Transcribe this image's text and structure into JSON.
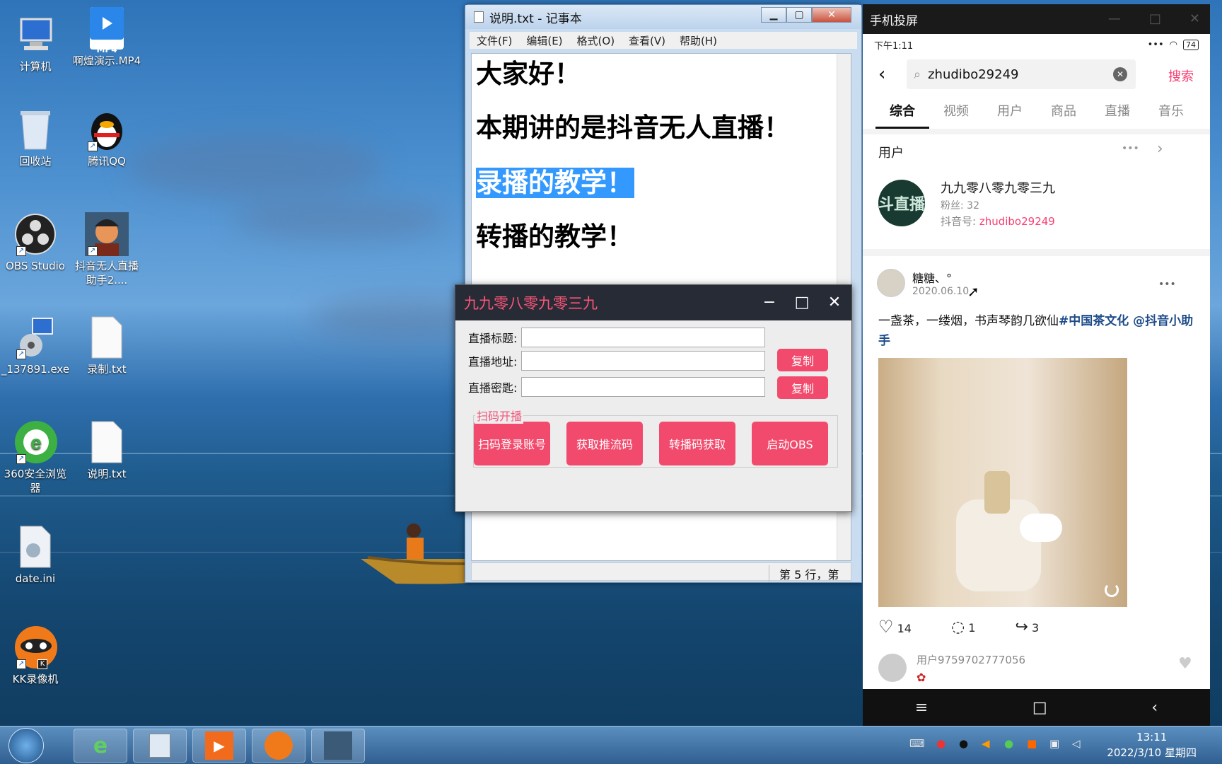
{
  "desktop": {
    "icons": [
      {
        "label": "计算机",
        "icon": "computer-icon"
      },
      {
        "label": "啊煌演示.MP4",
        "icon": "mp4-file-icon",
        "badge": "MP4"
      },
      {
        "label": "回收站",
        "icon": "recycle-bin-icon"
      },
      {
        "label": "腾讯QQ",
        "icon": "qq-penguin-icon"
      },
      {
        "label": "OBS Studio",
        "icon": "obs-icon"
      },
      {
        "label": "抖音无人直播助手2....",
        "icon": "app-avatar-icon"
      },
      {
        "label": "_137891.exe",
        "icon": "installer-icon"
      },
      {
        "label": "录制.txt",
        "icon": "text-file-icon"
      },
      {
        "label": "360安全浏览器",
        "icon": "browser-360-icon"
      },
      {
        "label": "说明.txt",
        "icon": "text-file-icon"
      },
      {
        "label": "date.ini",
        "icon": "ini-file-icon"
      },
      {
        "label": "KK录像机",
        "icon": "kk-recorder-icon",
        "badge": "K"
      }
    ]
  },
  "notepad": {
    "title": "说明.txt - 记事本",
    "menu": [
      "文件(F)",
      "编辑(E)",
      "格式(O)",
      "查看(V)",
      "帮助(H)"
    ],
    "lines": [
      "大家好！",
      "本期讲的是抖音无人直播！",
      "录播的教学！",
      "转播的教学！"
    ],
    "status": "第 5 行，第"
  },
  "tool": {
    "title": "九九零八零九零三九",
    "fields": [
      {
        "label": "直播标题:",
        "value": ""
      },
      {
        "label": "直播地址:",
        "value": ""
      },
      {
        "label": "直播密匙:",
        "value": ""
      }
    ],
    "copy_label": "复制",
    "group_label": "扫码开播",
    "buttons": [
      "扫码登录账号",
      "获取推流码",
      "转播码获取",
      "启动OBS"
    ]
  },
  "phone": {
    "window_title": "手机投屏",
    "time": "下午1:11",
    "battery": "74",
    "search_value": "zhudibo29249",
    "search_button": "搜索",
    "tabs": [
      "综合",
      "视频",
      "用户",
      "商品",
      "直播",
      "音乐"
    ],
    "active_tab": 0,
    "users_section": "用户",
    "user": {
      "avatar_text": "斗直播",
      "name": "九九零八零九零三九",
      "fans": "粉丝: 32",
      "id_label": "抖音号: ",
      "id": "zhudibo29249"
    },
    "post": {
      "author": "糖糖、°",
      "date": "2020.06.10",
      "text": "一盏茶，一缕烟，书声琴韵几欲仙",
      "tags": "#中国茶文化 @抖音小助手",
      "likes": "14",
      "comments": "1",
      "shares": "3"
    },
    "commenter": "用户9759702777056"
  },
  "taskbar": {
    "time": "13:11",
    "date": "2022/3/10 星期四"
  }
}
